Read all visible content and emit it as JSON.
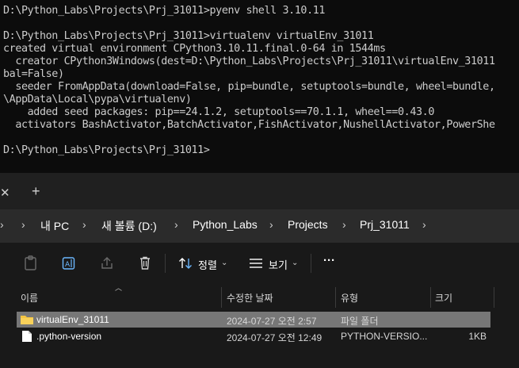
{
  "terminal": {
    "lines": [
      "D:\\Python_Labs\\Projects\\Prj_31011>pyenv shell 3.10.11",
      "",
      "D:\\Python_Labs\\Projects\\Prj_31011>virtualenv virtualEnv_31011",
      "created virtual environment CPython3.10.11.final.0-64 in 1544ms",
      "  creator CPython3Windows(dest=D:\\Python_Labs\\Projects\\Prj_31011\\virtualEnv_31011",
      "bal=False)",
      "  seeder FromAppData(download=False, pip=bundle, setuptools=bundle, wheel=bundle,",
      "\\AppData\\Local\\pypa\\virtualenv)",
      "    added seed packages: pip==24.1.2, setuptools==70.1.1, wheel==0.43.0",
      "  activators BashActivator,BatchActivator,FishActivator,NushellActivator,PowerShe",
      "",
      "D:\\Python_Labs\\Projects\\Prj_31011>"
    ]
  },
  "explorer": {
    "tabbar": {
      "close_glyph": "✕",
      "new_glyph": "+"
    },
    "breadcrumb": [
      "내 PC",
      "새 볼륨 (D:)",
      "Python_Labs",
      "Projects",
      "Prj_31011"
    ],
    "toolbar": {
      "sort_label": "정렬",
      "view_label": "보기",
      "more_glyph": "···"
    },
    "columns": {
      "name": "이름",
      "modified": "수정한 날짜",
      "type": "유형",
      "size": "크기"
    },
    "files": [
      {
        "name": "virtualEnv_31011",
        "modified": "2024-07-27 오전 2:57",
        "type": "파일 폴더",
        "size": "",
        "icon": "folder-icon",
        "selected": true
      },
      {
        "name": ".python-version",
        "modified": "2024-07-27 오전 12:49",
        "type": "PYTHON-VERSIO...",
        "size": "1KB",
        "icon": "file-icon",
        "selected": false
      }
    ]
  },
  "colors": {
    "terminal_bg": "#0c0c0c",
    "terminal_text": "#cccccc",
    "explorer_bg": "#191919",
    "address_bg": "#2b2b2b",
    "folder": "#f4c542",
    "selection": "#777777",
    "accent": "#6cb8ff"
  }
}
